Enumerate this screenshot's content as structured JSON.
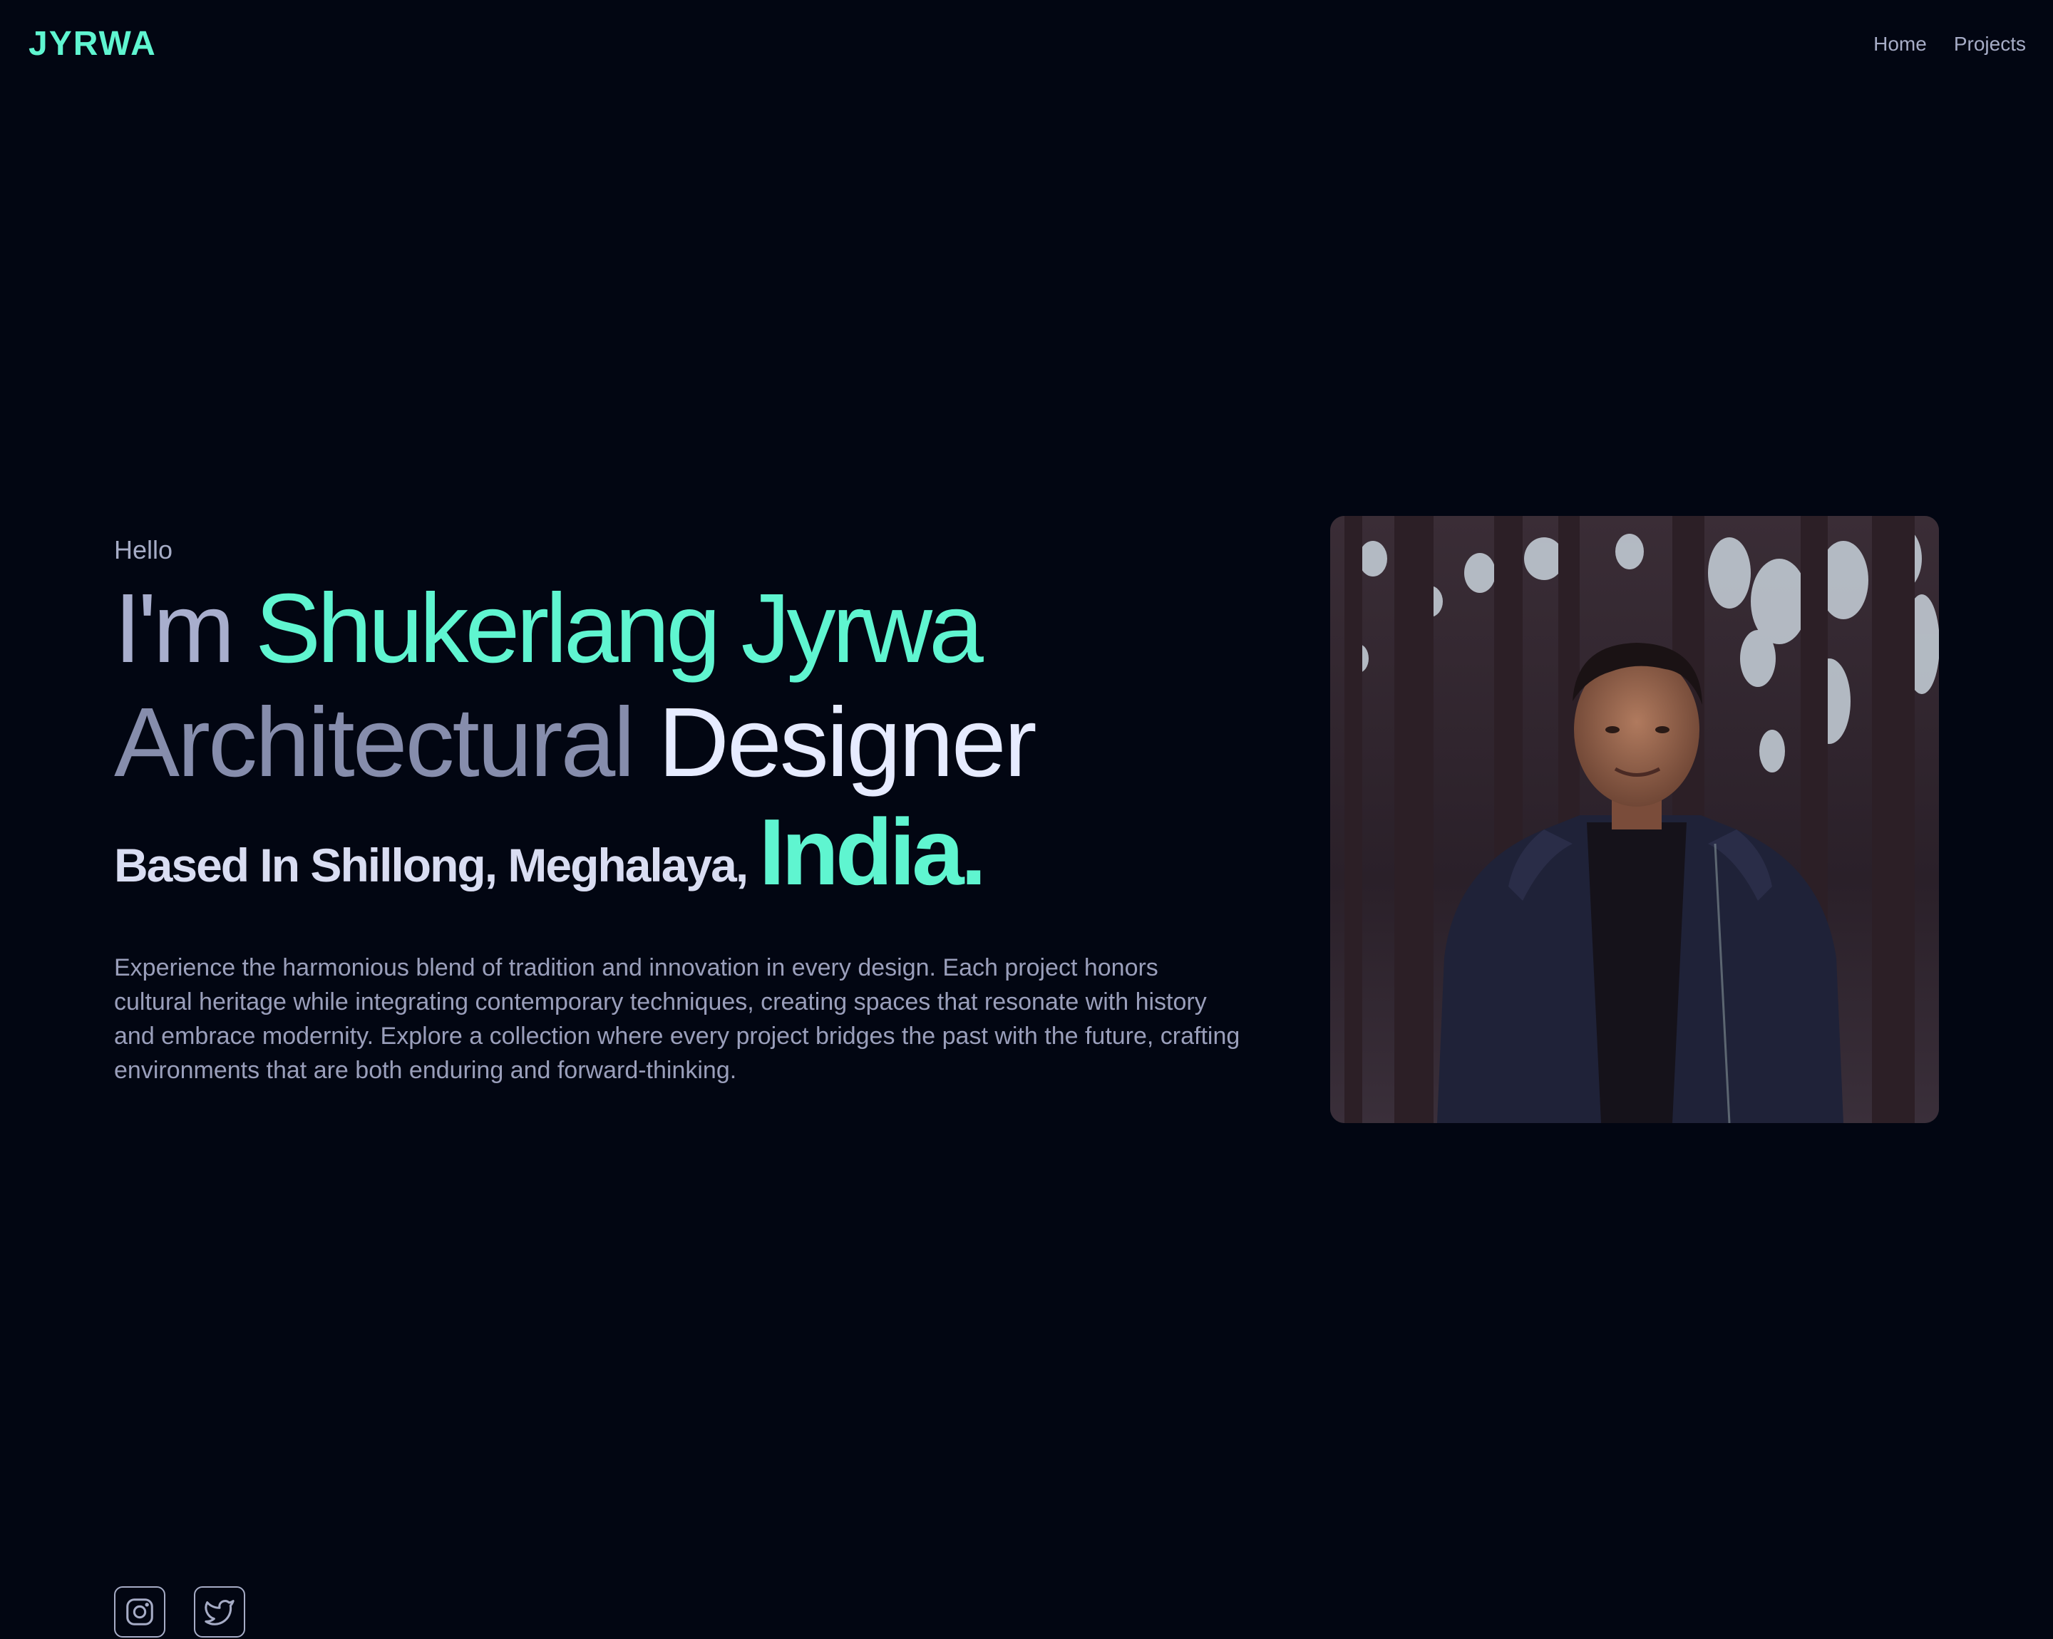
{
  "brand": {
    "logo": "JYRWA",
    "accent_color": "#5ff5d0"
  },
  "nav": {
    "items": [
      {
        "label": "Home"
      },
      {
        "label": "Projects"
      }
    ]
  },
  "hero": {
    "greeting": "Hello",
    "intro_prefix": "I'm",
    "name": "Shukerlang Jyrwa",
    "role_part1": "Architectural",
    "role_part2": "Designer",
    "location_prefix": "Based In Shillong, Meghalaya,",
    "location_country": "India.",
    "description": "Experience the harmonious blend of tradition and innovation in every design. Each project honors cultural heritage while integrating contemporary techniques, creating spaces that resonate with history and embrace modernity. Explore a collection where every project bridges the past with the future, crafting environments that are both enduring and forward-thinking."
  },
  "portrait": {
    "subject": "portrait photo of a man in a dark jacket standing in a forest"
  },
  "socials": [
    {
      "icon": "instagram-icon"
    },
    {
      "icon": "twitter-icon"
    }
  ],
  "colors": {
    "background": "#020612",
    "muted_text": "#a6acc6",
    "bright_text": "#e6ebff"
  }
}
